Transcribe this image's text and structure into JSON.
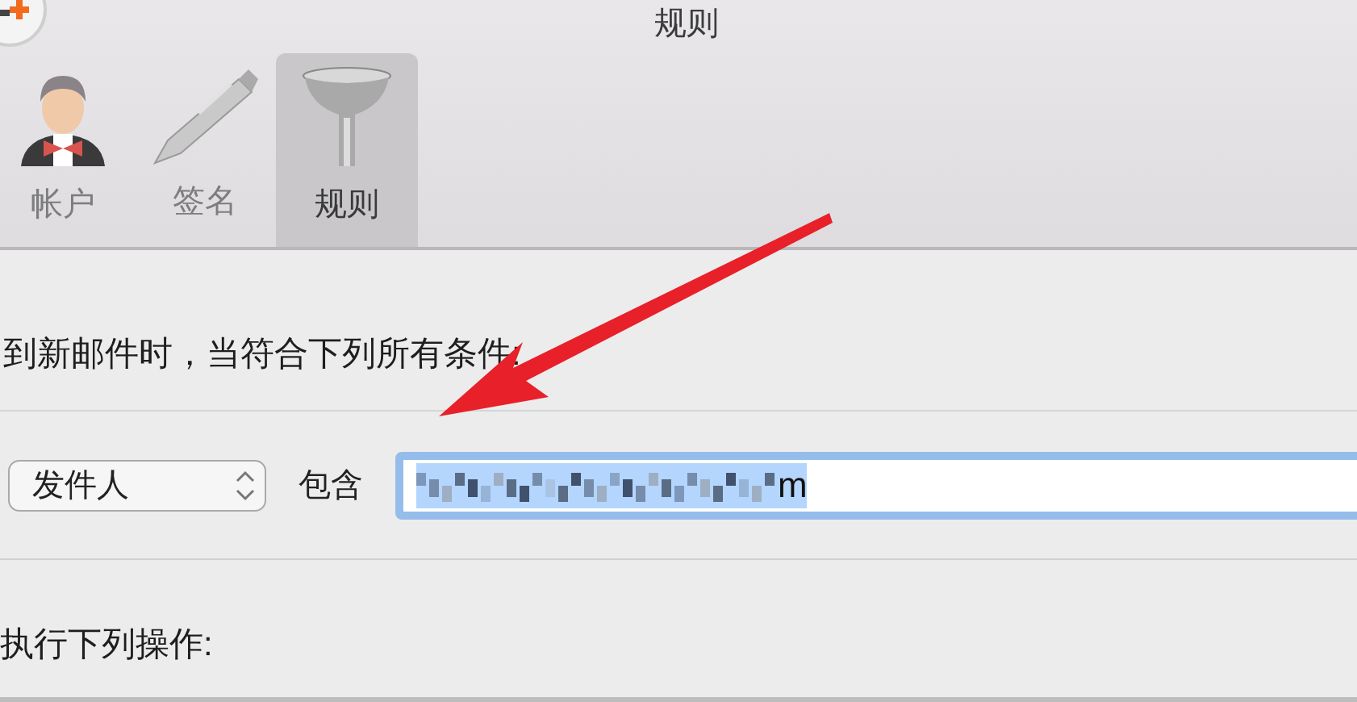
{
  "window": {
    "title": "规则"
  },
  "tabs": [
    {
      "label": "帐户",
      "kind": "person",
      "selected": false
    },
    {
      "label": "签名",
      "kind": "pen",
      "selected": false
    },
    {
      "label": "规则",
      "kind": "funnel",
      "selected": true
    }
  ],
  "conditions_intro": "到新邮件时，当符合下列所有条件:",
  "condition": {
    "field": "发件人",
    "operator": "包含",
    "value": "m",
    "value_selected": true
  },
  "actions_intro": "执行下列操作:"
}
